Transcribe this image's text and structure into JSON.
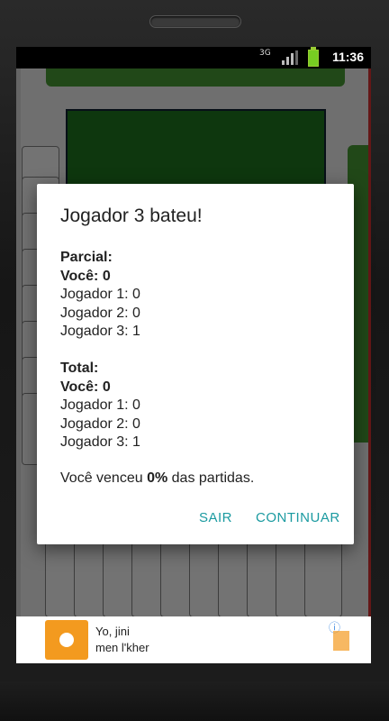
{
  "status": {
    "time": "11:36",
    "network": "3G"
  },
  "dialog": {
    "title": "Jogador 3 bateu!",
    "partial": {
      "heading": "Parcial:",
      "you": "Você: 0",
      "p1": "Jogador 1: 0",
      "p2": "Jogador 2: 0",
      "p3": "Jogador 3: 1"
    },
    "total": {
      "heading": "Total:",
      "you": "Você: 0",
      "p1": "Jogador 1: 0",
      "p2": "Jogador 2: 0",
      "p3": "Jogador 3: 1"
    },
    "summary_prefix": "Você venceu ",
    "summary_pct": "0%",
    "summary_suffix": " das partidas.",
    "btn_exit": "SAIR",
    "btn_continue": "CONTINUAR"
  },
  "ad": {
    "line1": "Yo, jini",
    "line2": "men l'kher",
    "info_icon": "info-icon"
  },
  "colors": {
    "accent": "#1a9aa0",
    "felt": "#1f7a1f"
  }
}
